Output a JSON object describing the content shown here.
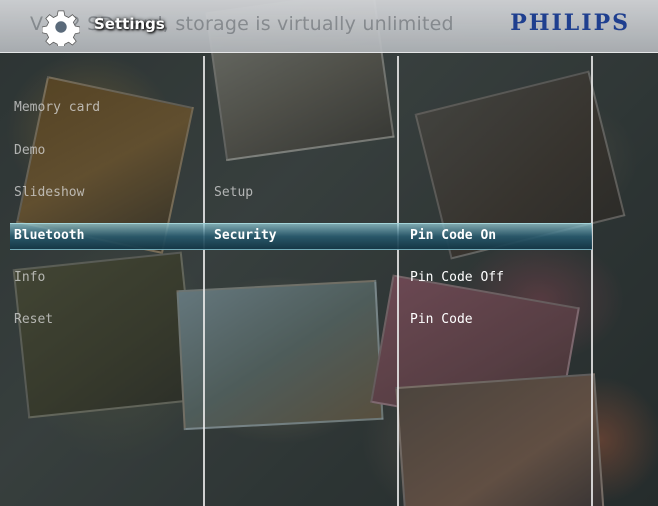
{
  "header": {
    "tagline": "V… 2 SD card, storage is virtually unlimited",
    "title": "Settings",
    "brand": "PHILIPS"
  },
  "menu": {
    "column1": [
      "Memory card",
      "Demo",
      "Slideshow",
      "Bluetooth",
      "Info",
      "Reset"
    ],
    "column2": [
      "Setup",
      "Security"
    ],
    "column3": [
      "Pin Code On",
      "Pin Code Off",
      "Pin Code"
    ]
  },
  "colors": {
    "brand": "#1f3f8f",
    "highlight": "#2a6a80"
  },
  "icons": {
    "settings": "gear-icon"
  }
}
